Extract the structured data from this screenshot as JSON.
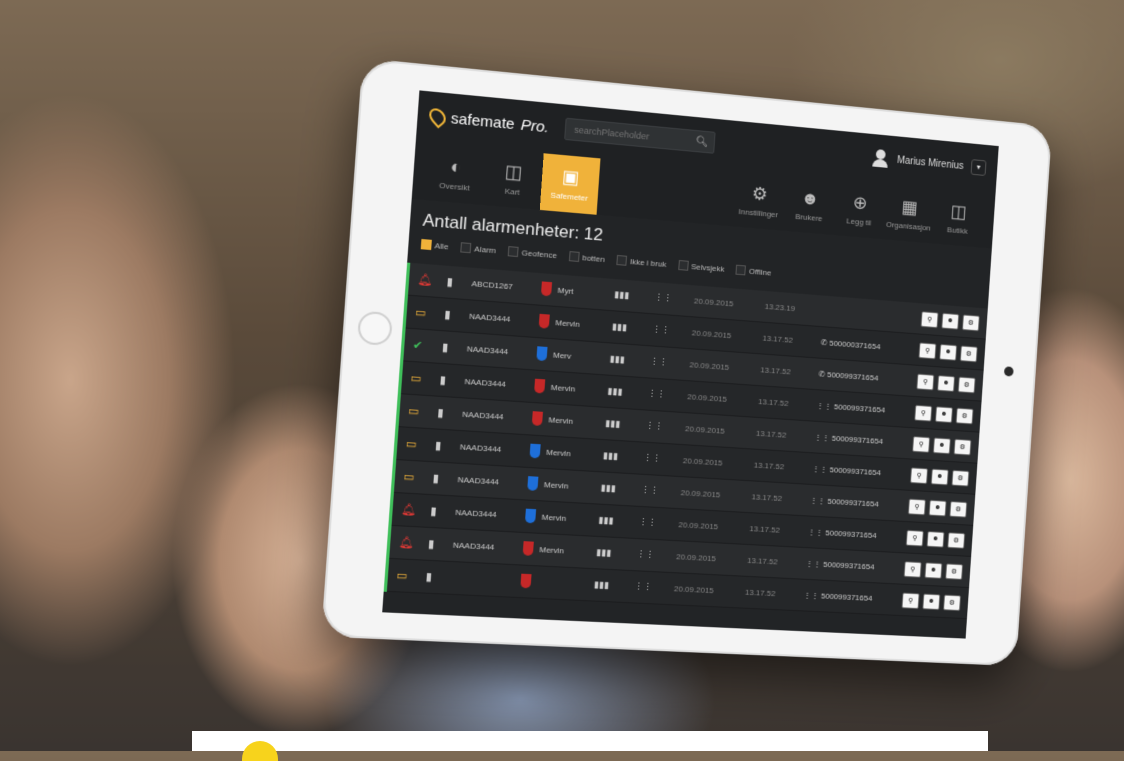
{
  "app": {
    "brand": "safemate",
    "brand_suffix": "Pro."
  },
  "search": {
    "placeholder": "searchPlaceholder"
  },
  "user": {
    "name": "Marius Mirenius"
  },
  "nav_left": [
    {
      "label": "Oversikt",
      "icon": "gauge-icon"
    },
    {
      "label": "Kart",
      "icon": "map-icon"
    },
    {
      "label": "Safemeter",
      "icon": "device-icon",
      "active": true
    }
  ],
  "nav_right": [
    {
      "label": "Innstillinger",
      "icon": "settings-icon"
    },
    {
      "label": "Brukere",
      "icon": "users-icon"
    },
    {
      "label": "Legg til",
      "icon": "add-icon"
    },
    {
      "label": "Organisasjon",
      "icon": "building-icon"
    },
    {
      "label": "Butikk",
      "icon": "cart-icon"
    }
  ],
  "page_title": "Antall alarmenheter: 12",
  "filters": [
    {
      "label": "Alle",
      "checked": true
    },
    {
      "label": "Alarm",
      "checked": false
    },
    {
      "label": "Geofence",
      "checked": false
    },
    {
      "label": "botten",
      "checked": false
    },
    {
      "label": "Ikke i bruk",
      "checked": false
    },
    {
      "label": "Selvsjekk",
      "checked": false
    },
    {
      "label": "Offline",
      "checked": false
    }
  ],
  "colors": {
    "accent": "#f0b23a",
    "alarm": "#e53935",
    "ok": "#3fbf5a",
    "crest_red": "#c62828",
    "crest_blue": "#1e6fd9"
  },
  "rows": [
    {
      "status": "alarm",
      "id": "ABCD1267",
      "crest": "red",
      "name": "Myrt",
      "date": "20.09.2015",
      "time": "13.23.19",
      "phone": "",
      "phone_icon": ""
    },
    {
      "status": "battery",
      "id": "NAAD3444",
      "crest": "red",
      "name": "Mervin",
      "date": "20.09.2015",
      "time": "13.17.52",
      "phone": "500000371654",
      "phone_icon": "phone"
    },
    {
      "status": "ok",
      "id": "NAAD3444",
      "crest": "blue",
      "name": "Merv",
      "date": "20.09.2015",
      "time": "13.17.52",
      "phone": "500099371654",
      "phone_icon": "phone"
    },
    {
      "status": "battery",
      "id": "NAAD3444",
      "crest": "red",
      "name": "Mervin",
      "date": "20.09.2015",
      "time": "13.17.52",
      "phone": "500099371654",
      "phone_icon": "steps"
    },
    {
      "status": "battery",
      "id": "NAAD3444",
      "crest": "red",
      "name": "Mervin",
      "date": "20.09.2015",
      "time": "13.17.52",
      "phone": "500099371654",
      "phone_icon": "steps"
    },
    {
      "status": "battery",
      "id": "NAAD3444",
      "crest": "blue",
      "name": "Mervin",
      "date": "20.09.2015",
      "time": "13.17.52",
      "phone": "500099371654",
      "phone_icon": "steps"
    },
    {
      "status": "battery",
      "id": "NAAD3444",
      "crest": "blue",
      "name": "Mervin",
      "date": "20.09.2015",
      "time": "13.17.52",
      "phone": "500099371654",
      "phone_icon": "steps"
    },
    {
      "status": "alarm",
      "id": "NAAD3444",
      "crest": "blue",
      "name": "Mervin",
      "date": "20.09.2015",
      "time": "13.17.52",
      "phone": "500099371654",
      "phone_icon": "steps"
    },
    {
      "status": "alarm",
      "id": "NAAD3444",
      "crest": "red",
      "name": "Mervin",
      "date": "20.09.2015",
      "time": "13.17.52",
      "phone": "500099371654",
      "phone_icon": "steps"
    },
    {
      "status": "battery",
      "id": "",
      "crest": "red",
      "name": "",
      "date": "20.09.2015",
      "time": "13.17.52",
      "phone": "500099371654",
      "phone_icon": "steps"
    }
  ]
}
